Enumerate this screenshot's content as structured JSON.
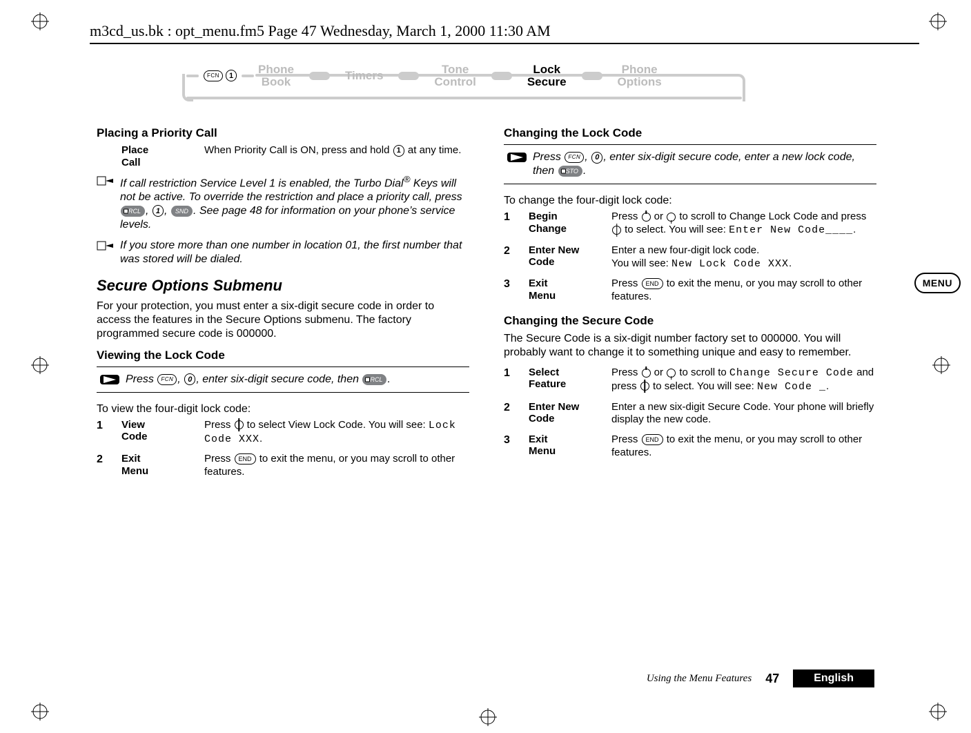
{
  "runhead": "m3cd_us.bk : opt_menu.fm5  Page 47  Wednesday, March 1, 2000  11:30 AM",
  "ribbon": {
    "keys": {
      "fcn": "FCN",
      "digit": "1"
    },
    "items": [
      {
        "label": "Phone\nBook",
        "active": false
      },
      {
        "label": "Timers",
        "active": false
      },
      {
        "label": "Tone\nControl",
        "active": false
      },
      {
        "label": "Lock\nSecure",
        "active": true
      },
      {
        "label": "Phone\nOptions",
        "active": false
      }
    ]
  },
  "left": {
    "placing_heading": "Placing a Priority Call",
    "place_step": {
      "label": "Place\nCall",
      "desc_pre": "When Priority Call is ON, press and hold ",
      "desc_key": "1",
      "desc_post": " at any time."
    },
    "note1_pre": "If call restriction Service Level 1 is enabled, the Turbo Dial",
    "note1_reg": "®",
    "note1_mid": " Keys will not be active. To override the restriction and place a priority call, press ",
    "note1_keys": {
      "rcl": "RCL",
      "one": "1",
      "snd": "SND"
    },
    "note1_post": ". See page 48 for information on your phone’s service levels.",
    "note2": "If you store more than one number in location 01, the first number that was stored will be dialed.",
    "secure_heading": "Secure Options Submenu",
    "secure_para": "For your protection, you must enter a six-digit secure code in order to access the features in the Secure Options submenu. The factory programmed secure code is 000000.",
    "view_heading": "Viewing the Lock Code",
    "view_quick_pre": "Press ",
    "view_quick_keys": {
      "fcn": "FCN",
      "zero": "0"
    },
    "view_quick_mid": ", enter six-digit secure code, then ",
    "view_quick_end": "RCL",
    "view_quick_period": ".",
    "view_intro": "To view the four-digit lock code:",
    "step1": {
      "num": "1",
      "label": "View\nCode",
      "pre": "Press ",
      "mid": " to select View Lock Code. You will see: ",
      "lcd": "Lock Code XXX",
      "post": "."
    },
    "step2": {
      "num": "2",
      "label": "Exit\nMenu",
      "pre": "Press ",
      "key": "END",
      "post": " to exit the menu, or you may scroll to other features."
    }
  },
  "right": {
    "change_lock_heading": "Changing the Lock Code",
    "change_lock_quick_pre": "Press ",
    "change_lock_keys": {
      "fcn": "FCN",
      "zero": "0"
    },
    "change_lock_quick_mid": ", enter six-digit secure code, enter a new lock code, then ",
    "change_lock_quick_end": "STO",
    "change_lock_quick_period": ".",
    "change_lock_intro": "To change the four-digit lock code:",
    "cl_step1": {
      "num": "1",
      "label": "Begin\nChange",
      "pre": "Press ",
      "mid1": " or ",
      "mid2": " to scroll to Change Lock Code and press ",
      "mid3": " to select. You will see: ",
      "lcd": "Enter New Code____",
      "post": "."
    },
    "cl_step2": {
      "num": "2",
      "label": "Enter New\nCode",
      "line1": "Enter a new four-digit lock code.",
      "line2_pre": "You will see: ",
      "lcd": "New Lock Code XXX",
      "line2_post": "."
    },
    "cl_step3": {
      "num": "3",
      "label": "Exit\nMenu",
      "pre": "Press ",
      "key": "END",
      "post": " to exit the menu, or you may scroll to other features."
    },
    "change_secure_heading": "Changing the Secure Code",
    "change_secure_para": "The Secure Code is a six-digit number factory set to 000000. You will probably want to change it to something unique and easy to remember.",
    "cs_step1": {
      "num": "1",
      "label": "Select\nFeature",
      "pre": "Press ",
      "mid1": " or ",
      "mid2": " to scroll to ",
      "lcd1": "Change Secure Code",
      "mid3": " and press ",
      "mid4": " to select. You will see: ",
      "lcd2": "New Code _",
      "post": "."
    },
    "cs_step2": {
      "num": "2",
      "label": "Enter New\nCode",
      "text": "Enter a new six-digit Secure Code. Your phone will briefly display the new code."
    },
    "cs_step3": {
      "num": "3",
      "label": "Exit\nMenu",
      "pre": "Press ",
      "key": "END",
      "post": " to exit the menu, or you may scroll to other features."
    }
  },
  "side_tab": "MENU",
  "footer": {
    "chapter": "Using the Menu Features",
    "page": "47",
    "lang": "English"
  }
}
